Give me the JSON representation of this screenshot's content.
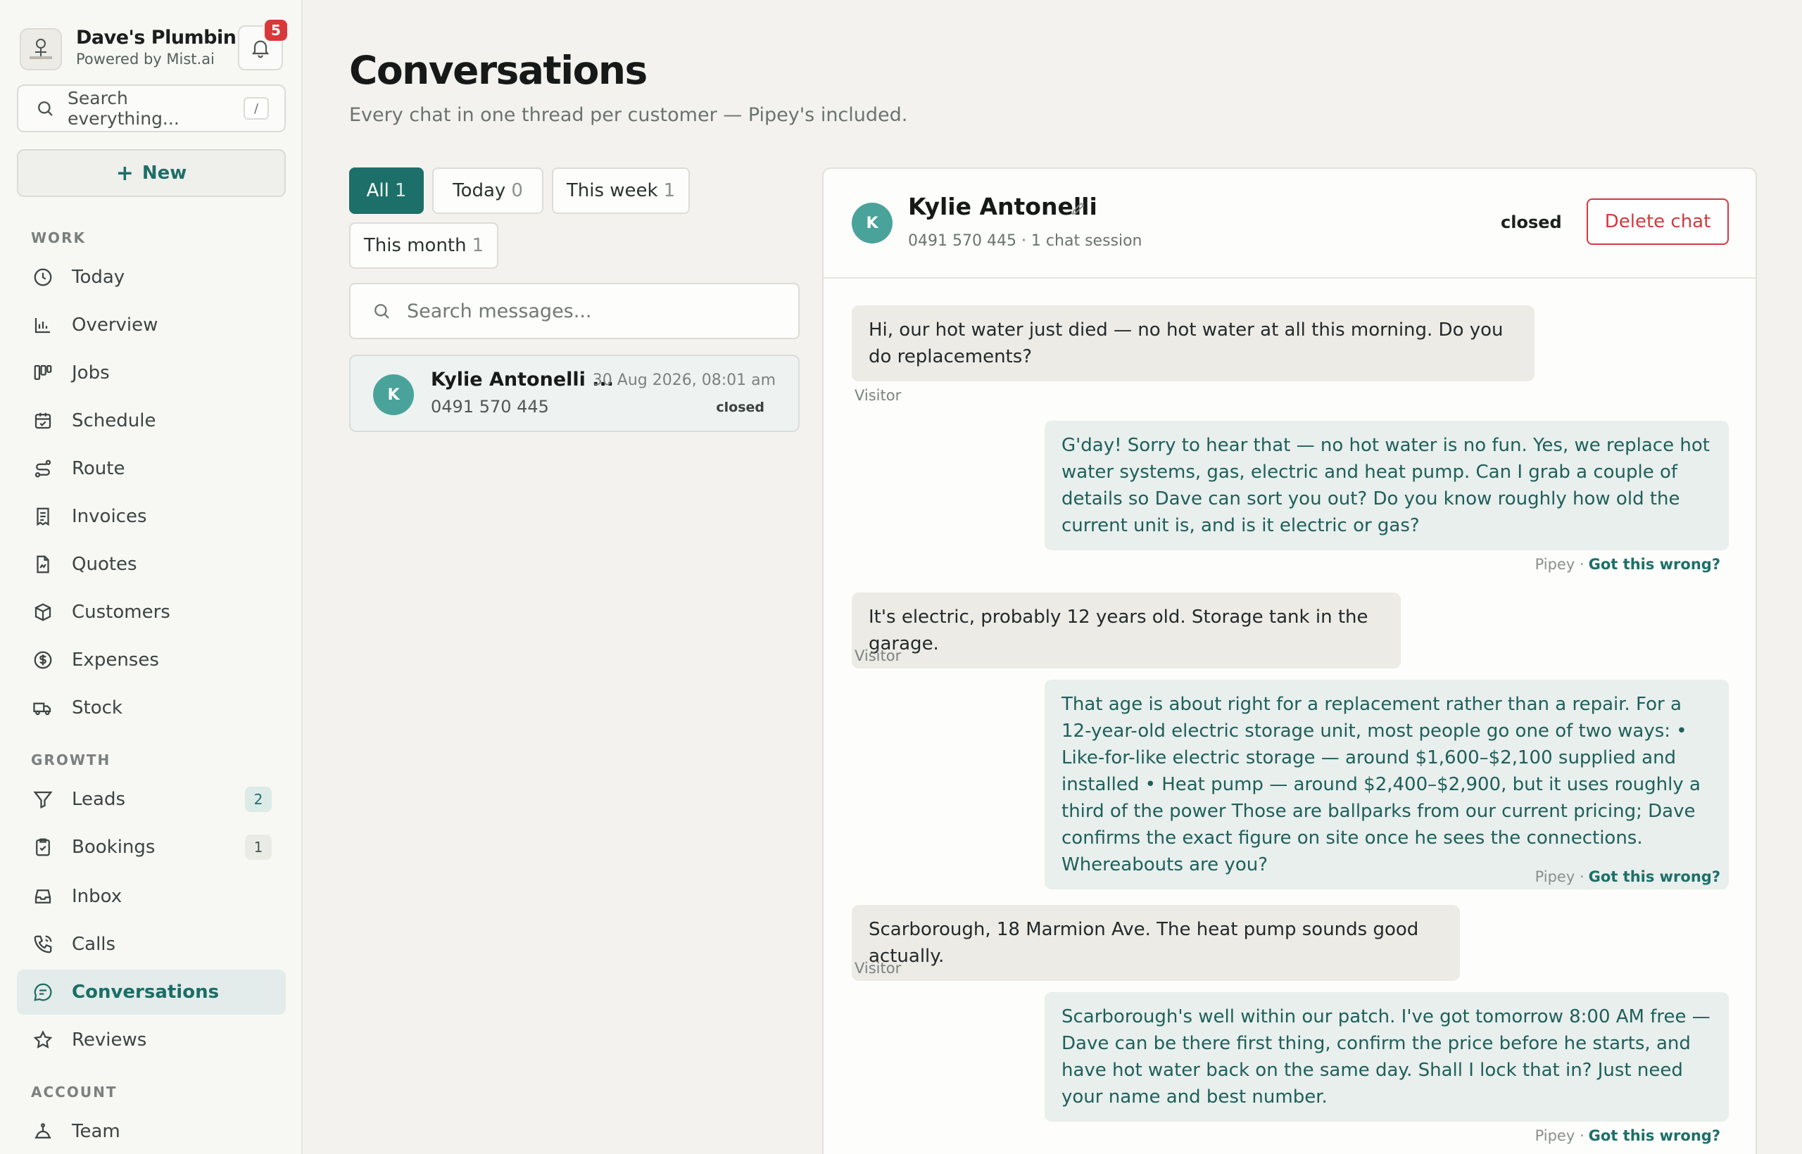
{
  "brand": {
    "name": "Dave's Plumbin...",
    "sub": "Powered by Mist.ai",
    "notifications": "5"
  },
  "sidebar": {
    "search_placeholder": "Search everything...",
    "search_shortcut": "/",
    "new_label": "New",
    "sections": {
      "work": "WORK",
      "growth": "GROWTH",
      "account": "ACCOUNT"
    },
    "items": [
      {
        "label": "Today",
        "icon": "clock-icon"
      },
      {
        "label": "Overview",
        "icon": "bar-chart-icon"
      },
      {
        "label": "Jobs",
        "icon": "kanban-icon"
      },
      {
        "label": "Schedule",
        "icon": "calendar-icon"
      },
      {
        "label": "Route",
        "icon": "route-icon"
      },
      {
        "label": "Invoices",
        "icon": "receipt-icon"
      },
      {
        "label": "Quotes",
        "icon": "document-icon"
      },
      {
        "label": "Customers",
        "icon": "box-icon"
      },
      {
        "label": "Expenses",
        "icon": "dollar-icon"
      },
      {
        "label": "Stock",
        "icon": "truck-icon"
      },
      {
        "label": "Leads",
        "icon": "filter-icon",
        "count": "2"
      },
      {
        "label": "Bookings",
        "icon": "clipboard-check-icon",
        "count": "1"
      },
      {
        "label": "Inbox",
        "icon": "inbox-icon"
      },
      {
        "label": "Calls",
        "icon": "phone-icon"
      },
      {
        "label": "Conversations",
        "icon": "chat-icon",
        "active": true
      },
      {
        "label": "Reviews",
        "icon": "star-icon"
      },
      {
        "label": "Team",
        "icon": "team-icon"
      }
    ]
  },
  "header": {
    "title": "Conversations",
    "subtitle": "Every chat in one thread per customer — Pipey's included."
  },
  "filters": [
    {
      "label": "All",
      "count": "1",
      "active": true
    },
    {
      "label": "Today",
      "count": "0"
    },
    {
      "label": "This week",
      "count": "1"
    },
    {
      "label": "This month",
      "count": "1"
    }
  ],
  "message_search": {
    "placeholder": "Search messages..."
  },
  "conversation_list": [
    {
      "initial": "K",
      "name": "Kylie Antonelli ...",
      "phone": "0491 570 445",
      "date": "30 Aug 2026, 08:01 am",
      "status": "closed"
    }
  ],
  "chat": {
    "initial": "K",
    "name": "Kylie Antonelli",
    "meta": "0491 570 445 · 1 chat session",
    "status": "closed",
    "delete_label": "Delete chat",
    "visitor_label": "Visitor",
    "bot_label": "Pipey ·",
    "wrong_label": "Got this wrong?",
    "messages": [
      {
        "from": "visitor",
        "text": "Hi, our hot water just died — no hot water at all this morning. Do you do replacements?"
      },
      {
        "from": "bot",
        "text": "G'day! Sorry to hear that — no hot water is no fun. Yes, we replace hot water systems, gas, electric and heat pump. Can I grab a couple of details so Dave can sort you out? Do you know roughly how old the current unit is, and is it electric or gas?"
      },
      {
        "from": "visitor",
        "text": "It's electric, probably 12 years old. Storage tank in the garage."
      },
      {
        "from": "bot",
        "text": "That age is about right for a replacement rather than a repair. For a 12-year-old electric storage unit, most people go one of two ways: • Like-for-like electric storage — around $1,600–$2,100 supplied and installed • Heat pump — around $2,400–$2,900, but it uses roughly a third of the power Those are ballparks from our current pricing; Dave confirms the exact figure on site once he sees the connections. Whereabouts are you?"
      },
      {
        "from": "visitor",
        "text": "Scarborough, 18 Marmion Ave. The heat pump sounds good actually."
      },
      {
        "from": "bot",
        "text": "Scarborough's well within our patch. I've got tomorrow 8:00 AM free — Dave can be there first thing, confirm the price before he starts, and have hot water back on the same day. Shall I lock that in? Just need your name and best number."
      }
    ]
  }
}
